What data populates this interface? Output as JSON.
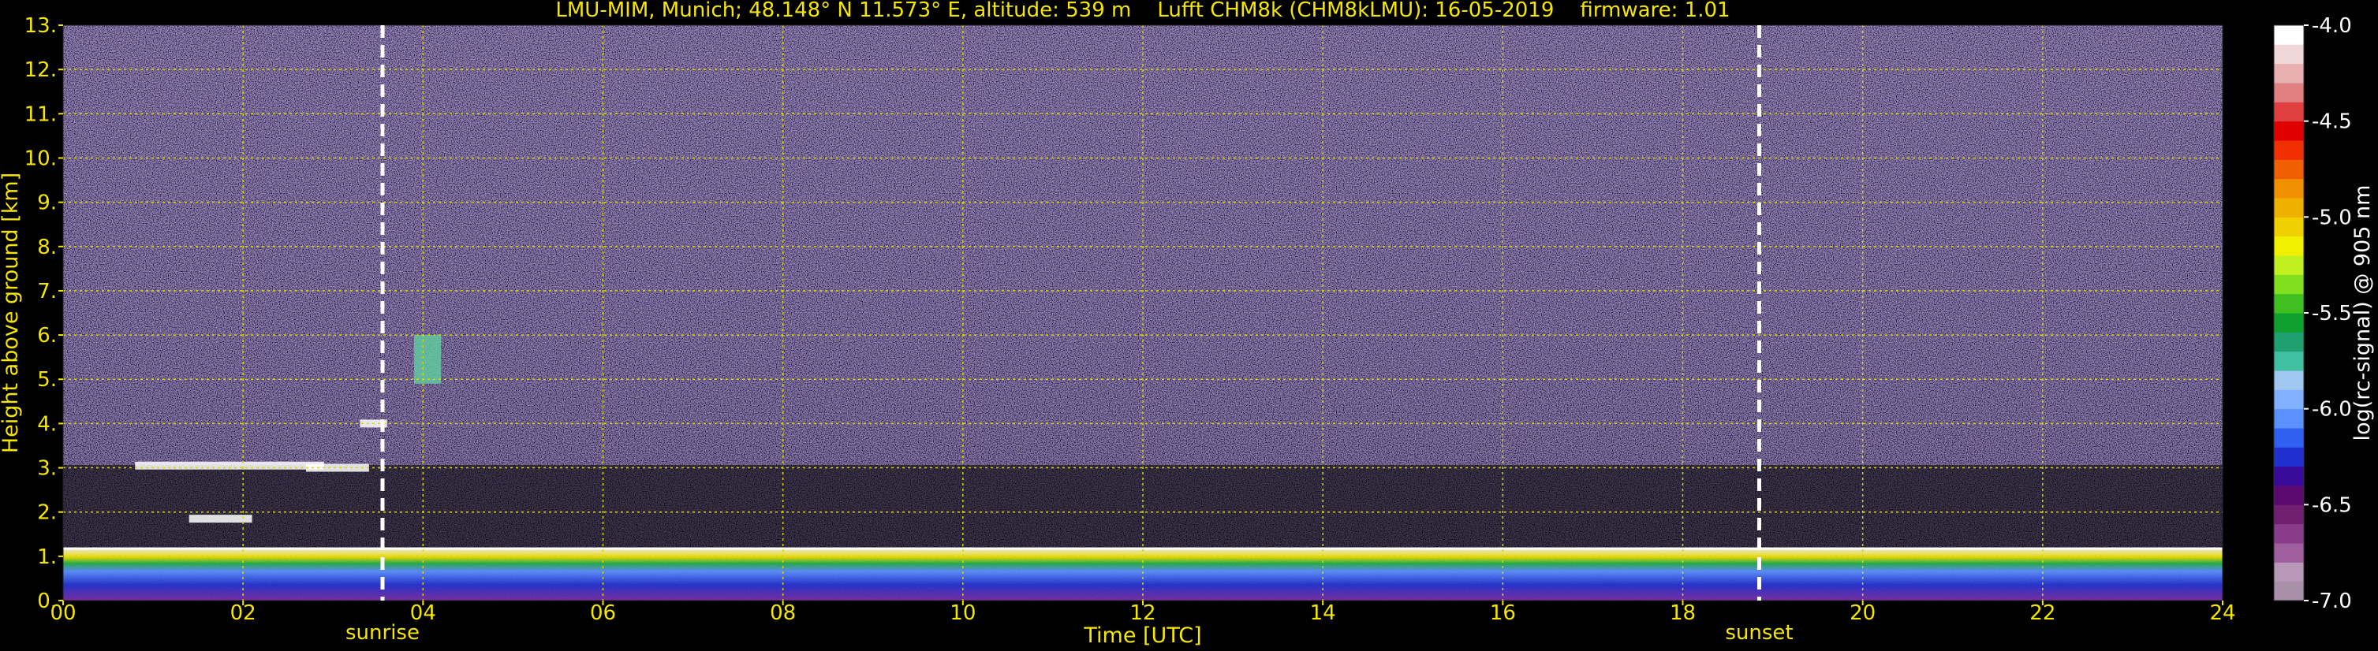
{
  "chart_data": {
    "type": "heatmap",
    "title": "LMU-MIM, Munich; 48.148° N 11.573° E, altitude: 539 m    Lufft CHM8k (CHM8kLMU): 16-05-2019    firmware: 1.01",
    "xlabel": "Time [UTC]",
    "ylabel": "Height above ground [km]",
    "xlim": [
      0,
      24
    ],
    "ylim": [
      0,
      13
    ],
    "x_ticks": [
      "00",
      "02",
      "04",
      "06",
      "08",
      "10",
      "12",
      "14",
      "16",
      "18",
      "20",
      "22",
      "24"
    ],
    "x_tick_values": [
      0,
      2,
      4,
      6,
      8,
      10,
      12,
      14,
      16,
      18,
      20,
      22,
      24
    ],
    "y_ticks": [
      "0.",
      "1.",
      "2.",
      "3.",
      "4.",
      "5.",
      "6.",
      "7.",
      "8.",
      "9.",
      "10.",
      "11.",
      "12.",
      "13."
    ],
    "y_tick_values": [
      0,
      1,
      2,
      3,
      4,
      5,
      6,
      7,
      8,
      9,
      10,
      11,
      12,
      13
    ],
    "grid": true,
    "markers": [
      {
        "label": "sunrise",
        "x": 3.55
      },
      {
        "label": "sunset",
        "x": 18.85
      }
    ],
    "colorbar": {
      "label": "log(rc-signal) @ 905 nm",
      "range": [
        -7.0,
        -4.0
      ],
      "ticks": [
        "-4.0",
        "-4.5",
        "-5.0",
        "-5.5",
        "-6.0",
        "-6.5",
        "-7.0"
      ],
      "tick_values": [
        -4.0,
        -4.5,
        -5.0,
        -5.5,
        -6.0,
        -6.5,
        -7.0
      ],
      "colors": [
        "#a890a8",
        "#b898b8",
        "#a060a0",
        "#8a3c8a",
        "#70206e",
        "#5a0a6e",
        "#3a0a9a",
        "#2030d0",
        "#3060f0",
        "#5a90ff",
        "#80b0ff",
        "#a0c8f0",
        "#40c0a0",
        "#20a070",
        "#10a030",
        "#40c020",
        "#80e020",
        "#c0f020",
        "#f0f000",
        "#f0d000",
        "#f0b000",
        "#f09000",
        "#f06000",
        "#f03000",
        "#e00000",
        "#e04040",
        "#e08080",
        "#e8b0b0",
        "#f0d8d8",
        "#ffffff"
      ]
    },
    "features": [
      {
        "name": "boundary layer",
        "x": [
          0,
          24
        ],
        "y": [
          0.0,
          1.2
        ]
      },
      {
        "name": "cloud layers",
        "x": [
          0.6,
          3.6
        ],
        "y": [
          1.8,
          4.1
        ]
      },
      {
        "name": "cloud",
        "x": [
          3.9,
          4.2
        ],
        "y": [
          4.9,
          6.0
        ]
      }
    ]
  },
  "colors": {
    "text": "#f5e600",
    "grid": "#d8d800",
    "marker": "#ffffff",
    "background": "#000000"
  }
}
